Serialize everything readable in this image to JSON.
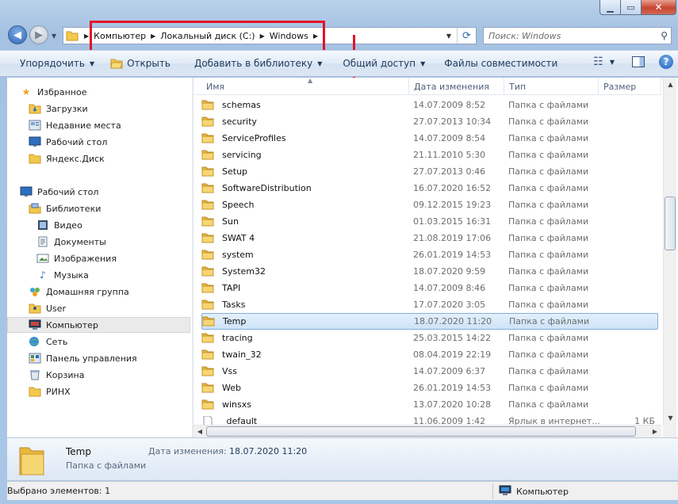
{
  "address": {
    "crumbs": [
      "Компьютер",
      "Локальный диск (C:)",
      "Windows"
    ]
  },
  "search": {
    "placeholder": "Поиск: Windows"
  },
  "toolbar": {
    "organize": "Упорядочить",
    "open": "Открыть",
    "add_library": "Добавить в библиотеку",
    "share": "Общий доступ",
    "compat_files": "Файлы совместимости",
    "help": "?"
  },
  "navpane": {
    "favorites": "Избранное",
    "downloads": "Загрузки",
    "recent": "Недавние места",
    "desktop_fav": "Рабочий стол",
    "yadisk": "Яндекс.Диск",
    "desktop": "Рабочий стол",
    "libraries": "Библиотеки",
    "video": "Видео",
    "documents": "Документы",
    "images": "Изображения",
    "music": "Музыка",
    "homegroup": "Домашняя группа",
    "user": "User",
    "computer": "Компьютер",
    "network": "Сеть",
    "control_panel": "Панель управления",
    "recycle": "Корзина",
    "rinh": "РИНХ"
  },
  "columns": {
    "name": "Имя",
    "date": "Дата изменения",
    "type": "Тип",
    "size": "Размер"
  },
  "files": [
    {
      "name": "schemas",
      "date": "14.07.2009 8:52",
      "type": "Папка с файлами",
      "size": ""
    },
    {
      "name": "security",
      "date": "27.07.2013 10:34",
      "type": "Папка с файлами",
      "size": ""
    },
    {
      "name": "ServiceProfiles",
      "date": "14.07.2009 8:54",
      "type": "Папка с файлами",
      "size": ""
    },
    {
      "name": "servicing",
      "date": "21.11.2010 5:30",
      "type": "Папка с файлами",
      "size": ""
    },
    {
      "name": "Setup",
      "date": "27.07.2013 0:46",
      "type": "Папка с файлами",
      "size": ""
    },
    {
      "name": "SoftwareDistribution",
      "date": "16.07.2020 16:52",
      "type": "Папка с файлами",
      "size": ""
    },
    {
      "name": "Speech",
      "date": "09.12.2015 19:23",
      "type": "Папка с файлами",
      "size": ""
    },
    {
      "name": "Sun",
      "date": "01.03.2015 16:31",
      "type": "Папка с файлами",
      "size": ""
    },
    {
      "name": "SWAT 4",
      "date": "21.08.2019 17:06",
      "type": "Папка с файлами",
      "size": ""
    },
    {
      "name": "system",
      "date": "26.01.2019 14:53",
      "type": "Папка с файлами",
      "size": ""
    },
    {
      "name": "System32",
      "date": "18.07.2020 9:59",
      "type": "Папка с файлами",
      "size": ""
    },
    {
      "name": "TAPI",
      "date": "14.07.2009 8:46",
      "type": "Папка с файлами",
      "size": ""
    },
    {
      "name": "Tasks",
      "date": "17.07.2020 3:05",
      "type": "Папка с файлами",
      "size": ""
    },
    {
      "name": "Temp",
      "date": "18.07.2020 11:20",
      "type": "Папка с файлами",
      "size": ""
    },
    {
      "name": "tracing",
      "date": "25.03.2015 14:22",
      "type": "Папка с файлами",
      "size": ""
    },
    {
      "name": "twain_32",
      "date": "08.04.2019 22:19",
      "type": "Папка с файлами",
      "size": ""
    },
    {
      "name": "Vss",
      "date": "14.07.2009 6:37",
      "type": "Папка с файлами",
      "size": ""
    },
    {
      "name": "Web",
      "date": "26.01.2019 14:53",
      "type": "Папка с файлами",
      "size": ""
    },
    {
      "name": "winsxs",
      "date": "13.07.2020 10:28",
      "type": "Папка с файлами",
      "size": ""
    },
    {
      "name": "_default",
      "date": "11.06.2009 1:42",
      "type": "Ярлык в интернет...",
      "size": "1 КБ"
    }
  ],
  "details": {
    "name": "Temp",
    "type": "Папка с файлами",
    "date_label": "Дата изменения:",
    "date_value": "18.07.2020 11:20"
  },
  "status": {
    "selected": "Выбрано элементов: 1",
    "computer": "Компьютер"
  },
  "colors": {
    "annotation": "#e5112b",
    "selection": "#cde3f8",
    "folder": "#f2c94c"
  }
}
